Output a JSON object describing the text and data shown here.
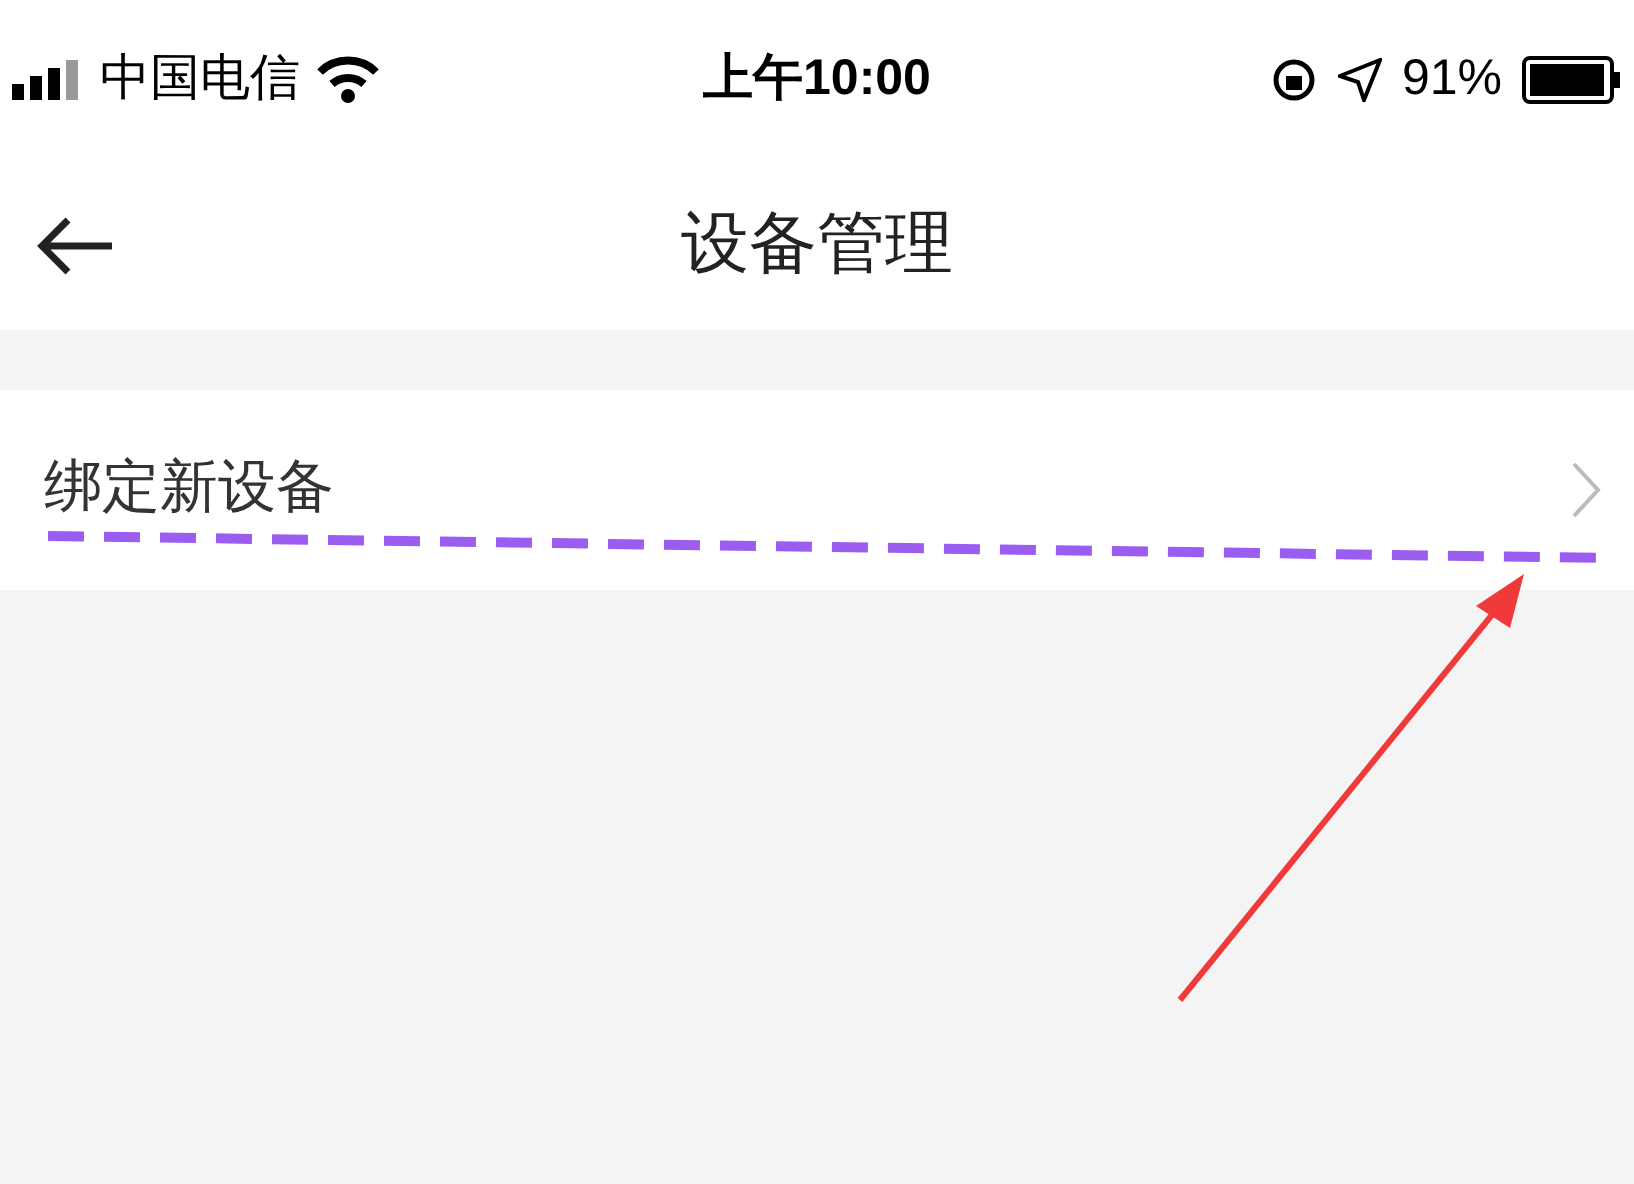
{
  "status_bar": {
    "carrier": "中国电信",
    "time": "上午10:00",
    "battery": "91%"
  },
  "header": {
    "title": "设备管理"
  },
  "menu_items": [
    {
      "label": "绑定新设备"
    }
  ]
}
